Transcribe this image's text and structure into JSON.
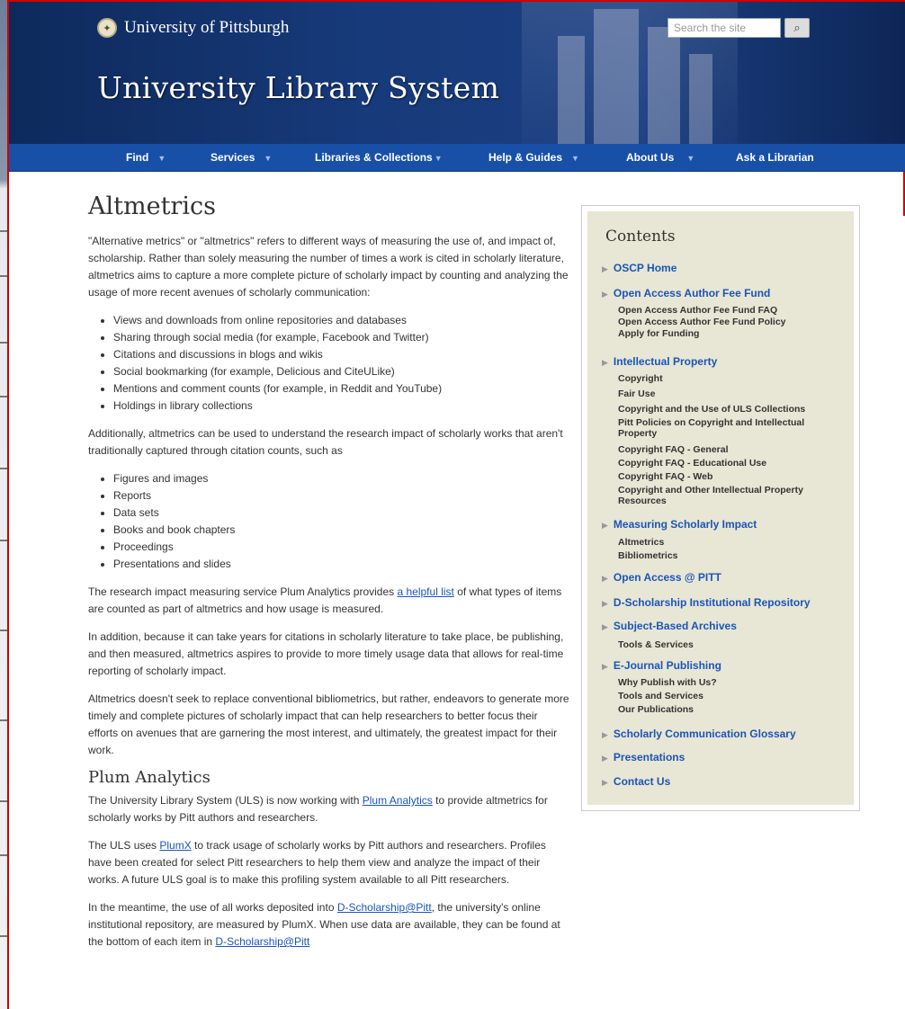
{
  "header": {
    "brand": "University of Pittsburgh",
    "site_title": "University Library System",
    "search_placeholder": "Search the site"
  },
  "nav": {
    "items": [
      {
        "label": "Find"
      },
      {
        "label": "Services"
      },
      {
        "label": "Libraries & Collections"
      },
      {
        "label": "Help & Guides"
      },
      {
        "label": "About Us"
      },
      {
        "label": "Ask a Librarian"
      }
    ]
  },
  "main": {
    "title": "Altmetrics",
    "intro": "\"Alternative metrics\" or \"altmetrics\" refers to different ways of measuring the use of, and impact of, scholarship. Rather than solely measuring the number of times a work is cited in scholarly literature, altmetrics aims to capture a more complete picture of scholarly impact by counting and analyzing the usage of more recent avenues of scholarly communication:",
    "list1": [
      "Views and downloads from online repositories and databases",
      "Sharing through social media (for example, Facebook and Twitter)",
      "Citations and discussions in blogs and wikis",
      "Social bookmarking (for example, Delicious and CiteULike)",
      "Mentions and comment counts (for example, in Reddit and YouTube)",
      "Holdings in library collections"
    ],
    "para2": "Additionally, altmetrics can be used to understand the research impact of scholarly works that aren't traditionally captured through citation counts, such as",
    "list2": [
      "Figures and images",
      "Reports",
      "Data sets",
      "Books and book chapters",
      "Proceedings",
      "Presentations and slides"
    ],
    "para3_before": "The research impact measuring service Plum Analytics provides ",
    "para3_link": "a helpful list",
    "para3_after": " of what types of items are counted as part of altmetrics and how usage is measured.",
    "para4": "In addition, because it can take years for citations in scholarly literature to take place, be publishing, and then measured,  altmetrics aspires to provide to more timely usage data that allows for real-time reporting of scholarly impact.",
    "para5": "Altmetrics doesn't seek to replace conventional bibliometrics, but rather, endeavors to generate more timely and complete pictures of scholarly impact that can help researchers to better focus their efforts on avenues that are garnering the most interest, and ultimately, the greatest impact for their work.",
    "subtitle": "Plum Analytics",
    "para6_before": "The University Library System (ULS) is now working with ",
    "para6_link": "Plum Analytics",
    "para6_after": " to provide altmetrics for scholarly works by Pitt authors and researchers.",
    "para7_before": "The ULS uses ",
    "para7_link": "PlumX",
    "para7_after": " to track usage of scholarly works by Pitt authors and researchers. Profiles have been created for select Pitt researchers to help them view and analyze the impact of their works. A future ULS goal is to make this profiling system available to all Pitt researchers.",
    "para8_before": "In the meantime, the use of all works deposited into ",
    "para8_link": "D-Scholarship@Pitt",
    "para8_after": ", the university's online institutional repository, are measured by PlumX. When use data are available, they can be found at the bottom of each item in ",
    "para8_link2": "D-Scholarship@Pitt"
  },
  "contents": {
    "title": "Contents",
    "items": {
      "oscp_home": "OSCP Home",
      "oa_fee_fund": "Open Access Author Fee Fund",
      "oa_fee_fund_faq": "Open Access Author Fee Fund FAQ",
      "oa_fee_fund_policy": "Open Access Author Fee Fund Policy",
      "apply_funding": "Apply for Funding",
      "intellectual_property": "Intellectual Property",
      "copyright": "Copyright",
      "fair_use": "Fair Use",
      "copyright_uls": "Copyright and the Use of ULS Collections",
      "pitt_policies": "Pitt Policies on Copyright and Intellectual Property",
      "faq_general": "Copyright FAQ - General",
      "faq_educational": "Copyright FAQ - Educational Use",
      "faq_web": "Copyright FAQ - Web",
      "copyright_other": "Copyright and Other Intellectual Property Resources",
      "measuring": "Measuring Scholarly Impact",
      "altmetrics": "Altmetrics",
      "bibliometrics": "Bibliometrics",
      "oa_pitt": "Open Access @ PITT",
      "dscholarship": "D-Scholarship Institutional Repository",
      "subject_archives": "Subject-Based Archives",
      "tools_services": "Tools & Services",
      "ejournal": "E-Journal Publishing",
      "why_publish": "Why Publish with Us?",
      "tools_and_services": "Tools and Services",
      "our_publications": "Our Publications",
      "glossary": "Scholarly Communication Glossary",
      "presentations": "Presentations",
      "contact": "Contact Us"
    }
  }
}
